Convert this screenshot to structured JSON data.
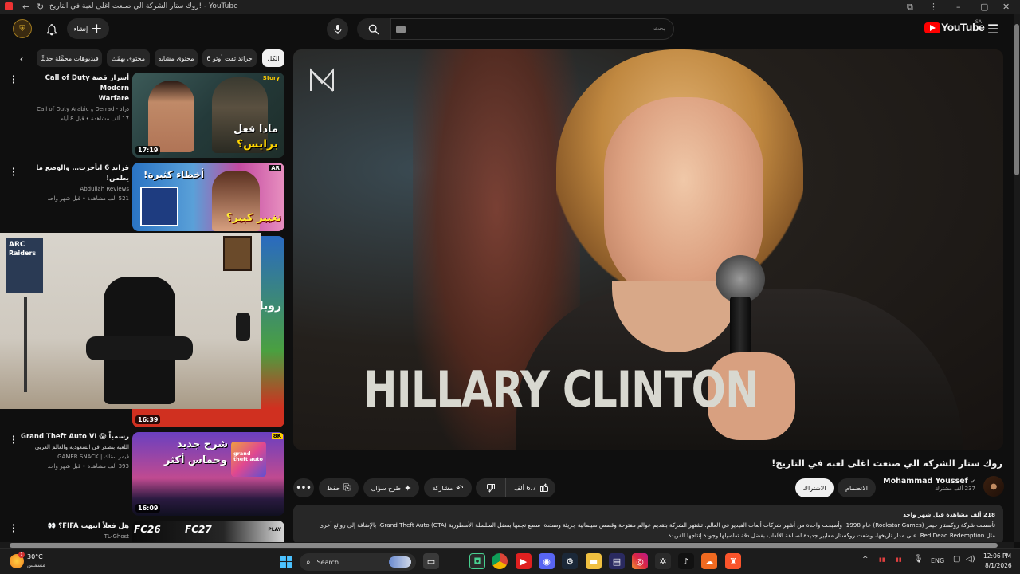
{
  "browser": {
    "tab_title": "روك ستار الشركة الي صنعت اغلى لعبة في التاريخ! - YouTube"
  },
  "header": {
    "logo_text": "YouTube",
    "region": "SA",
    "search_placeholder": "بحث",
    "create_label": "إنشاء"
  },
  "chips": [
    {
      "label": "الكل",
      "active": true
    },
    {
      "label": "جراند ثفت أوتو 6",
      "active": false
    },
    {
      "label": "محتوى مشابه",
      "active": false
    },
    {
      "label": "محتوى يهمّك",
      "active": false
    },
    {
      "label": "فيديوهات محمَّلة حديثًا",
      "active": false
    }
  ],
  "recommendations": [
    {
      "title_line1": "أسرار قصة Call of Duty Modern",
      "title_line2": "Warfare",
      "channel": "دراد - Derrad و Call of Duty Arabic",
      "meta": "17 ألف مشاهدة • قبل 8 أيام",
      "duration": "17:19",
      "thumb_text1": "ماذا فعل",
      "thumb_text2": "برايس؟",
      "thumb_badge": "Story"
    },
    {
      "title_line1": "قراند 6 اتأخرت… والوضع ما يطمن!",
      "channel": "Abdullah Reviews",
      "meta": "521 ألف مشاهدة • قبل شهر واحد",
      "thumb_text1": "أخطاء كثيرة!",
      "thumb_text2": "تغيير كبير؟",
      "thumb_badge": "AR"
    },
    {
      "duration": "16:39",
      "thumb_text1": "ARC",
      "thumb_text2": "Raiders",
      "side_text": "روبل ادما"
    },
    {
      "title_line1": "رسمياً 😱 Grand Theft Auto VI",
      "title_line2": "اللعبة بتصدر في السعودية والعالم العربي",
      "channel": "قيمر سناك | GAMER SNACK",
      "meta": "393 ألف مشاهدة • قبل شهر واحد",
      "duration": "16:09",
      "thumb_text1": "شرح جديد",
      "thumb_text2": "وحماس أكثر",
      "thumb_badge": "8K",
      "thumb_logo": "grand theft auto"
    },
    {
      "title_line1": "هل فعلاً انتهت FIFA؟ 👀",
      "channel": "TL-Ghost",
      "thumb_text1": "FC26",
      "thumb_text2": "FC27",
      "thumb_badge": "PLAY"
    }
  ],
  "pip": {
    "label1": "ARC",
    "label2": "Raiders"
  },
  "video": {
    "overlay_name": "HILLARY CLINTON",
    "overlay_logo": "M",
    "title": "روك ستار الشركة الي صنعت اغلى لعبة في التاريخ!",
    "channel_name": "Mohammad Youssef",
    "subscribers": "237 ألف مشترك",
    "join_label": "الانضمام",
    "subscribe_label": "الاشتراك",
    "likes": "6.7 ألف",
    "share_label": "مشاركة",
    "ask_label": "طرح سؤال",
    "save_label": "حفظ",
    "views_line": "218 ألف مشاهدة  قبل شهر واحد",
    "description_line1": "تأسست شركة روكستار جيمز (Rockstar Games) عام 1998، وأصبحت واحدة من أشهر شركات ألعاب الفيديو في العالم. تشتهر الشركة بتقديم عوالم مفتوحة وقصص سينمائية جريئة وممتدة، سطع نجمها بفضل السلسلة الأسطورية Grand Theft Auto (GTA)، بالإضافة إلى روائع أخرى",
    "description_line2": "مثل Red Dead Redemption. على مدار تاريخها، وضعت روكستار معايير جديدة لصناعة الألعاب بفضل دقة تفاصيلها وجودة إنتاجها الفريدة."
  },
  "taskbar": {
    "weather_temp": "30°C",
    "weather_desc": "مشمس",
    "search_label": "Search",
    "language": "ENG",
    "time": "12:06 PM",
    "date": "8/1/2026",
    "notif_count": "1"
  },
  "colors": {
    "bg": "#0f0f0f",
    "chip": "#272727",
    "yt_red": "#ff0000"
  }
}
